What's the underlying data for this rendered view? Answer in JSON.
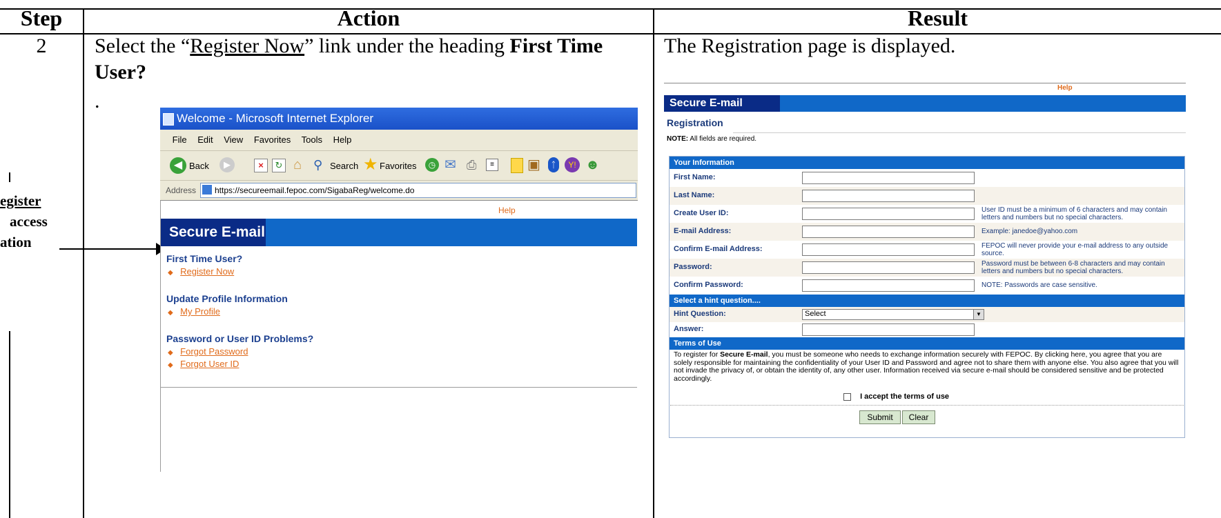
{
  "table": {
    "headers": {
      "step": "Step",
      "action": "Action",
      "result": "Result"
    },
    "row": {
      "step": "2",
      "action_pre": "Select the “",
      "action_link": "Register Now",
      "action_mid": "” link under the heading ",
      "action_bold_1": "First Time",
      "action_bold_2": "User?",
      "action_dot": ".",
      "result_text": "The Registration page is displayed."
    }
  },
  "callout": {
    "line1": "egister",
    "line2": "access",
    "line3": "ation"
  },
  "ie_window": {
    "title": "Welcome - Microsoft Internet Explorer",
    "menu": [
      "File",
      "Edit",
      "View",
      "Favorites",
      "Tools",
      "Help"
    ],
    "toolbar": {
      "back": "Back",
      "search": "Search",
      "favorites": "Favorites"
    },
    "address_label": "Address",
    "address_url": "https://secureemail.fepoc.com/SigabaReg/welcome.do",
    "page": {
      "help": "Help",
      "banner": "Secure E-mail",
      "sections": [
        {
          "heading": "First Time User?",
          "links": [
            "Register Now"
          ]
        },
        {
          "heading": "Update Profile Information",
          "links": [
            "My Profile"
          ]
        },
        {
          "heading": "Password or User ID Problems?",
          "links": [
            "Forgot Password",
            "Forgot User ID"
          ]
        }
      ]
    }
  },
  "registration": {
    "help": "Help",
    "banner": "Secure E-mail",
    "title": "Registration",
    "note_label": "NOTE:",
    "note_text": " All fields are required.",
    "section_info": "Your Information",
    "fields": [
      {
        "label": "First Name:",
        "hint": ""
      },
      {
        "label": "Last Name:",
        "hint": ""
      },
      {
        "label": "Create User ID:",
        "hint": "User ID must be a minimum of 6 characters and may contain letters and numbers but no special characters."
      },
      {
        "label": "E-mail Address:",
        "hint": "Example: janedoe@yahoo.com"
      },
      {
        "label": "Confirm E-mail Address:",
        "hint": "FEPOC will never provide your e-mail address to any outside source."
      },
      {
        "label": "Password:",
        "hint": "Password must be between 6-8 characters and may contain letters and numbers but no special characters."
      },
      {
        "label": "Confirm Password:",
        "hint": "NOTE: Passwords are case sensitive."
      }
    ],
    "section_hint": "Select a hint question....",
    "hint_question_label": "Hint Question:",
    "hint_select_value": "Select",
    "answer_label": "Answer:",
    "section_terms": "Terms of Use",
    "terms_pre": "To register for ",
    "terms_bold": "Secure E-mail",
    "terms_post": ", you must be someone who needs to exchange information securely with FEPOC. By clicking here, you agree that you are solely responsible for maintaining the confidentiality of your User ID and Password and agree not to share them with anyone else. You also agree that you will not invade the privacy of, or obtain the identity of, any other user. Information received via secure e-mail should be considered sensitive and be protected accordingly.",
    "accept_label": "I accept the terms of use",
    "submit": "Submit",
    "clear": "Clear"
  }
}
